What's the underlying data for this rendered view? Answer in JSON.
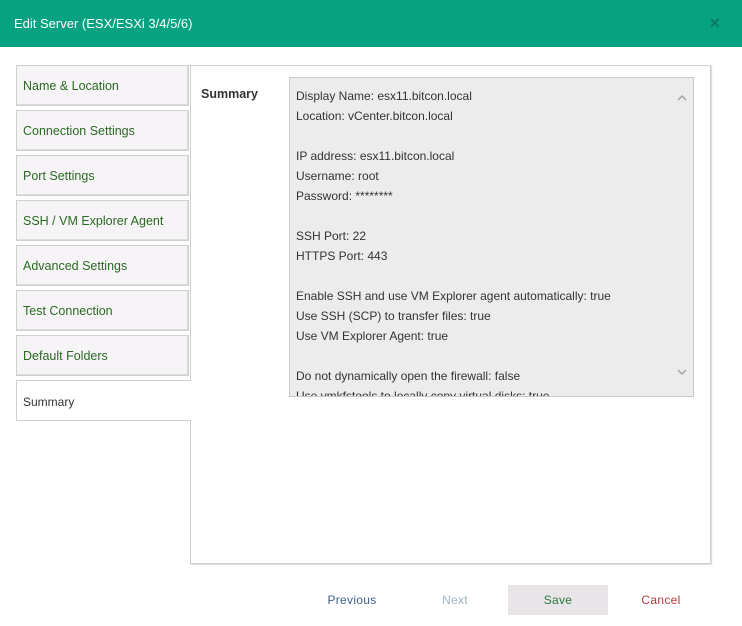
{
  "window": {
    "title": "Edit Server (ESX/ESXi 3/4/5/6)",
    "close_glyph": "×"
  },
  "sidebar": {
    "items": [
      {
        "label": "Name & Location"
      },
      {
        "label": "Connection Settings"
      },
      {
        "label": "Port Settings"
      },
      {
        "label": "SSH / VM Explorer Agent"
      },
      {
        "label": "Advanced Settings"
      },
      {
        "label": "Test Connection"
      },
      {
        "label": "Default Folders"
      },
      {
        "label": "Summary"
      }
    ],
    "active_index": 7
  },
  "summary": {
    "label": "Summary",
    "lines": [
      "Display Name: esx11.bitcon.local",
      "Location: vCenter.bitcon.local",
      "",
      "IP address: esx11.bitcon.local",
      "Username: root",
      "Password: ********",
      "",
      "SSH Port: 22",
      "HTTPS Port: 443",
      "",
      "Enable SSH and use VM Explorer agent automatically: true",
      "Use SSH (SCP) to transfer files: true",
      "Use VM Explorer Agent: true",
      "",
      "Do not dynamically open the firewall: false",
      "Use vmkfstools to locally copy virtual disks: true"
    ]
  },
  "footer": {
    "previous_label": "Previous",
    "next_label": "Next",
    "save_label": "Save",
    "cancel_label": "Cancel"
  },
  "colors": {
    "titlebar": "#07a282",
    "nav_text": "#2a6a22",
    "cancel": "#b83a3a"
  }
}
